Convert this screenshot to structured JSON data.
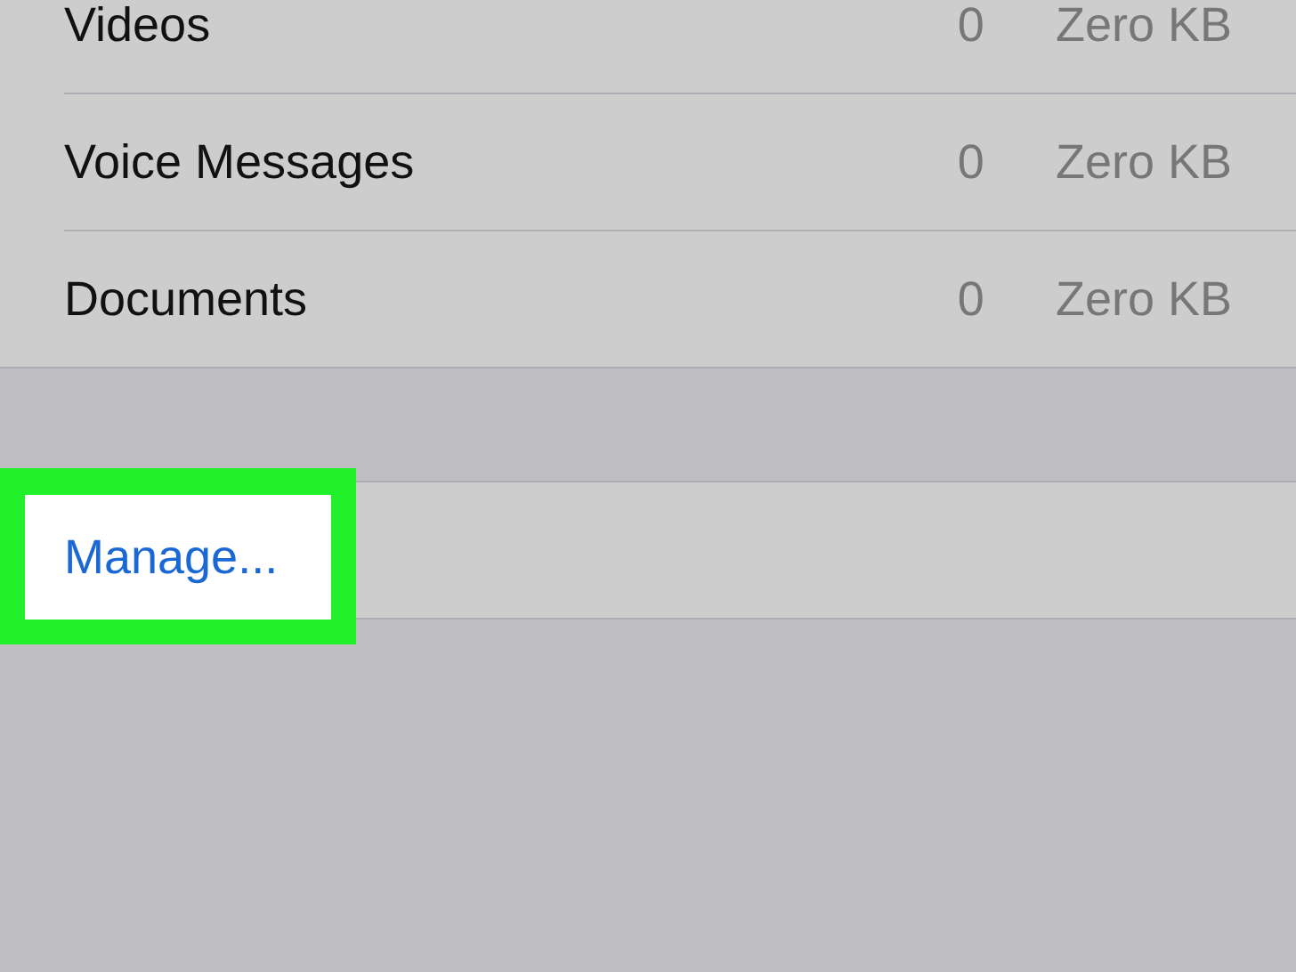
{
  "rows": [
    {
      "name": "Videos",
      "count": "0",
      "size": "Zero KB"
    },
    {
      "name": "Voice Messages",
      "count": "0",
      "size": "Zero KB"
    },
    {
      "name": "Documents",
      "count": "0",
      "size": "Zero KB"
    }
  ],
  "manage": {
    "label": "Manage...",
    "highlighted": true
  }
}
